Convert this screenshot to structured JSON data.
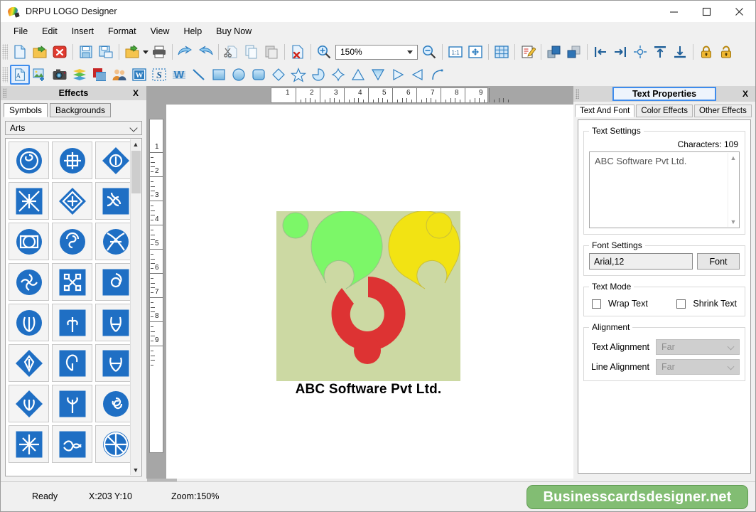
{
  "window": {
    "title": "DRPU LOGO Designer",
    "app_icon": "palette-icon",
    "minimize": "minimize-icon",
    "maximize": "maximize-icon",
    "close": "close-icon"
  },
  "menu": {
    "items": [
      "File",
      "Edit",
      "Insert",
      "Format",
      "View",
      "Help",
      "Buy Now"
    ]
  },
  "toolbar_main": {
    "zoom_value": "150%",
    "buttons": [
      {
        "name": "new-document-icon",
        "tip": "New"
      },
      {
        "name": "open-folder-icon",
        "tip": "Open"
      },
      {
        "name": "close-document-icon",
        "tip": "Close"
      },
      {
        "name": "save-icon",
        "tip": "Save"
      },
      {
        "name": "save-as-icon",
        "tip": "Save As"
      },
      {
        "name": "export-icon",
        "tip": "Export"
      },
      {
        "name": "print-icon",
        "tip": "Print"
      },
      {
        "name": "undo-icon",
        "tip": "Undo"
      },
      {
        "name": "redo-icon",
        "tip": "Redo"
      },
      {
        "name": "cut-icon",
        "tip": "Cut"
      },
      {
        "name": "copy-icon",
        "tip": "Copy"
      },
      {
        "name": "paste-icon",
        "tip": "Paste"
      },
      {
        "name": "delete-icon",
        "tip": "Delete"
      },
      {
        "name": "zoom-in-icon",
        "tip": "Zoom In"
      },
      {
        "name": "zoom-out-icon",
        "tip": "Zoom Out"
      },
      {
        "name": "actual-size-icon",
        "tip": "1:1"
      },
      {
        "name": "fit-page-icon",
        "tip": "Fit Page"
      },
      {
        "name": "grid-icon",
        "tip": "Grid"
      },
      {
        "name": "edit-note-icon",
        "tip": "Properties"
      },
      {
        "name": "bring-forward-icon",
        "tip": "Bring Forward"
      },
      {
        "name": "send-backward-icon",
        "tip": "Send Backward"
      },
      {
        "name": "align-left-icon",
        "tip": "Align Left"
      },
      {
        "name": "align-right-icon",
        "tip": "Align Right"
      },
      {
        "name": "align-center-icon",
        "tip": "Align Center"
      },
      {
        "name": "align-top-icon",
        "tip": "Align Top"
      },
      {
        "name": "align-bottom-icon",
        "tip": "Align Bottom"
      },
      {
        "name": "lock-icon",
        "tip": "Lock"
      },
      {
        "name": "unlock-icon",
        "tip": "Unlock"
      }
    ]
  },
  "toolbar_objects": {
    "selected": "add-text-icon",
    "buttons": [
      {
        "name": "add-text-icon"
      },
      {
        "name": "add-image-icon"
      },
      {
        "name": "camera-icon"
      },
      {
        "name": "layers-icon"
      },
      {
        "name": "barcode-icon"
      },
      {
        "name": "contacts-icon"
      },
      {
        "name": "word-art-icon"
      },
      {
        "name": "signature-icon"
      },
      {
        "name": "watermark-icon"
      },
      {
        "name": "line-icon"
      },
      {
        "name": "rectangle-icon"
      },
      {
        "name": "ellipse-icon"
      },
      {
        "name": "rounded-rectangle-icon"
      },
      {
        "name": "diamond-icon"
      },
      {
        "name": "star-icon"
      },
      {
        "name": "pie-icon"
      },
      {
        "name": "four-point-star-icon"
      },
      {
        "name": "triangle-up-icon"
      },
      {
        "name": "triangle-down-icon"
      },
      {
        "name": "triangle-right-icon"
      },
      {
        "name": "triangle-left-icon"
      },
      {
        "name": "arc-icon"
      }
    ]
  },
  "left_dock": {
    "title": "Effects",
    "close_label": "X",
    "tabs": [
      {
        "label": "Symbols",
        "active": true
      },
      {
        "label": "Backgrounds",
        "active": false
      }
    ],
    "category": "Arts",
    "symbol_count": 24
  },
  "canvas": {
    "h_ruler_ticks": [
      "1",
      "2",
      "3",
      "4",
      "5",
      "6",
      "7",
      "8",
      "9"
    ],
    "v_ruler_ticks": [
      "1",
      "2",
      "3",
      "4",
      "5",
      "6",
      "7",
      "8",
      "9"
    ],
    "logo": {
      "background_color": "#ccd9a3",
      "caption": "ABC Software Pvt Ltd.",
      "shapes": [
        {
          "name": "green-arc",
          "color": "#7cf768"
        },
        {
          "name": "yellow-arc",
          "color": "#f2e313"
        },
        {
          "name": "red-arc",
          "color": "#dd3333"
        }
      ]
    }
  },
  "right_dock": {
    "title": "Text Properties",
    "close_label": "X",
    "tabs": [
      {
        "label": "Text And Font",
        "active": true
      },
      {
        "label": "Color Effects",
        "active": false
      },
      {
        "label": "Other Effects",
        "active": false
      }
    ],
    "text_settings": {
      "legend": "Text Settings",
      "characters_label": "Characters: 109",
      "text_value": "ABC Software Pvt Ltd."
    },
    "font_settings": {
      "legend": "Font Settings",
      "font_value": "Arial,12",
      "font_button": "Font"
    },
    "text_mode": {
      "legend": "Text Mode",
      "wrap_text": "Wrap Text",
      "wrap_checked": false,
      "shrink_text": "Shrink Text",
      "shrink_checked": false
    },
    "alignment": {
      "legend": "Alignment",
      "text_alignment_label": "Text Alignment",
      "text_alignment_value": "Far",
      "line_alignment_label": "Line Alignment",
      "line_alignment_value": "Far"
    }
  },
  "status_bar": {
    "state": "Ready",
    "coords": "X:203  Y:10",
    "zoom": "Zoom:150%",
    "brand": "Businesscardsdesigner.net",
    "brand_color": "#82bd73"
  }
}
